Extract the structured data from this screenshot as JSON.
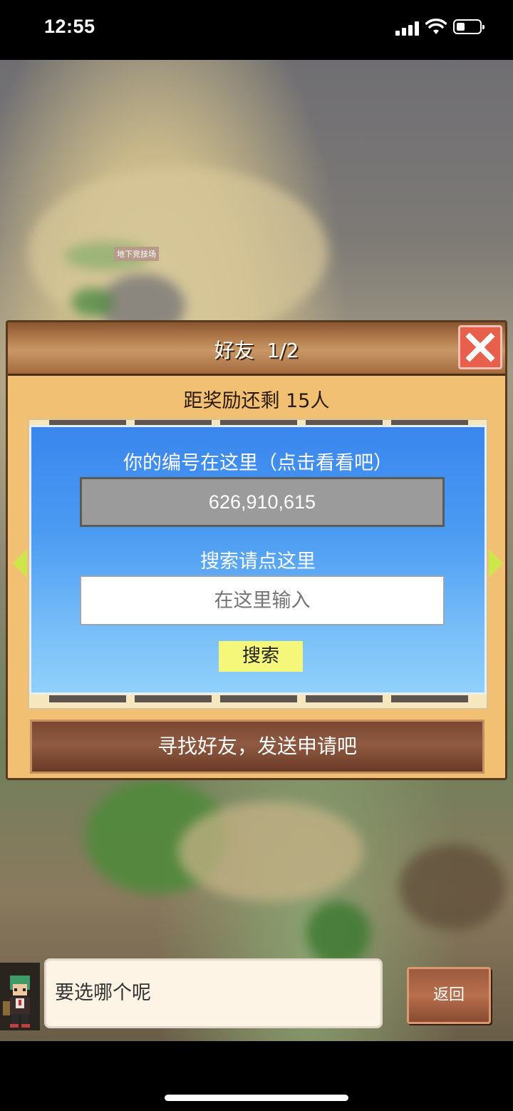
{
  "status_bar": {
    "time": "12:55"
  },
  "game_scene": {
    "place_label": "地下竞技场"
  },
  "dialog": {
    "title": "好友  1/2",
    "reward_text": "距奖励还剩 15人",
    "panel": {
      "id_label": "你的编号在这里（点击看看吧）",
      "id_value": "626,910,615",
      "search_label": "搜索请点这里",
      "search_placeholder": "在这里输入",
      "search_button": "搜索"
    },
    "find_friends_button": "寻找好友，发送申请吧"
  },
  "bottom": {
    "chat_text": "要选哪个呢",
    "back_button": "返回"
  },
  "colors": {
    "panel_blue": "#3a86ee",
    "close_red": "#e8604c",
    "search_button_yellow": "#f5f77a",
    "nav_arrow_green": "#cfe64a"
  }
}
